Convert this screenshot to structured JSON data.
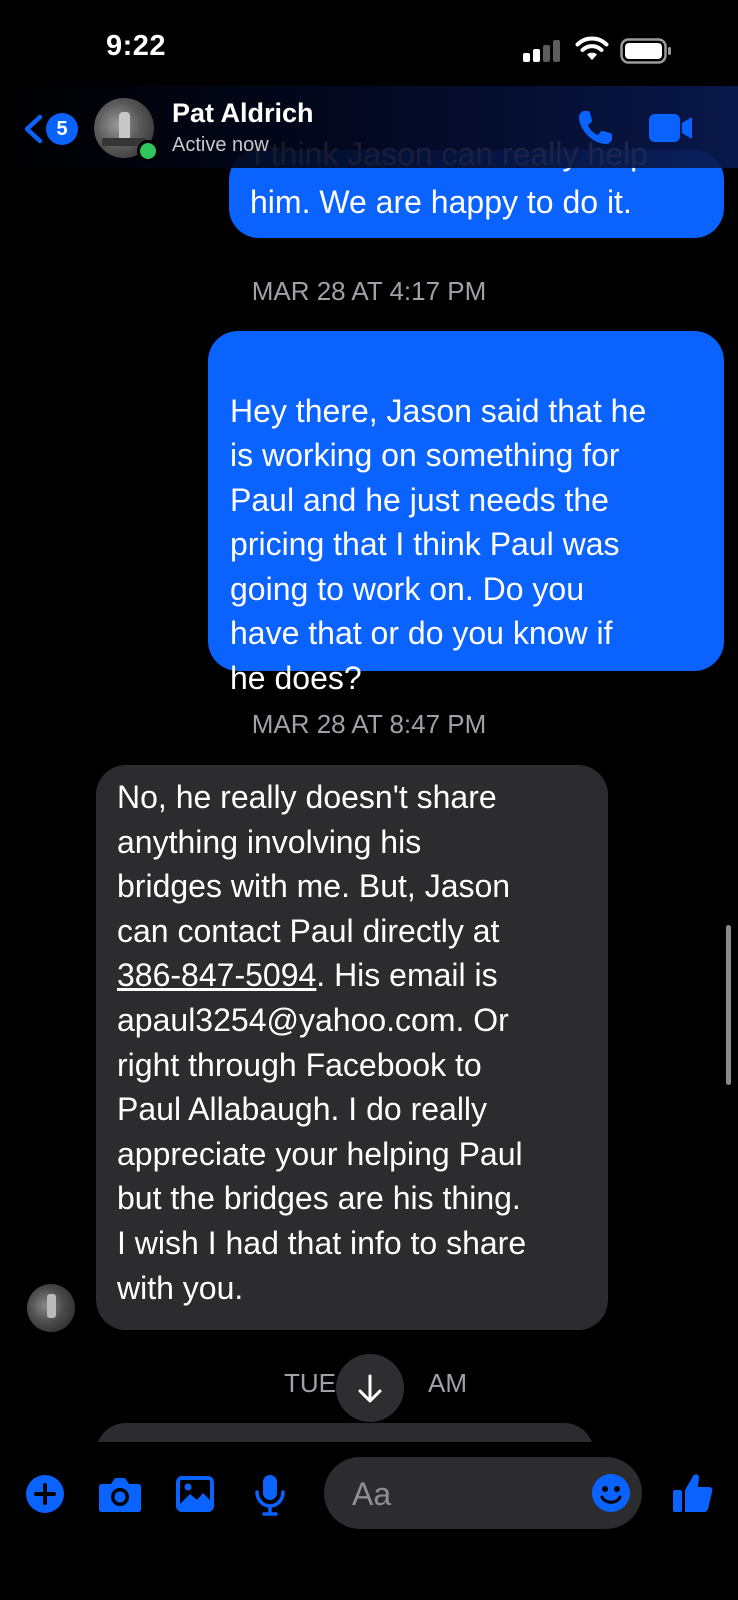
{
  "status_bar": {
    "time": "9:22"
  },
  "header": {
    "back_badge": "5",
    "contact_name": "Pat Aldrich",
    "contact_status": "Active now"
  },
  "messages": [
    {
      "direction": "outgoing",
      "text": "him. We are happy to do it.",
      "partial_hidden_line": "I think Jason can really help"
    },
    {
      "timestamp": "MAR 28 AT 4:17 PM"
    },
    {
      "direction": "outgoing",
      "text": "Hey there, Jason said that he\nis working on something for\nPaul and he just needs the\npricing that I think Paul was\ngoing to work on. Do you\nhave that or do you know if\nhe does?"
    },
    {
      "timestamp": "MAR 28 AT 8:47 PM"
    },
    {
      "direction": "incoming",
      "lines_before": "No,  he really doesn't share\nanything involving his\nbridges with me. But, Jason\ncan contact Paul directly at",
      "phone": "386-847-5094",
      "line_after_phone": ". His email is",
      "lines_after": "apaul3254@yahoo.com. Or\nright through Facebook to\nPaul Allabaugh. I do really\nappreciate your helping Paul\nbut the bridges are his thing.\nI wish I had that info to share\nwith you."
    },
    {
      "timestamp": "TUE … AM",
      "timestamp_left": "TUE",
      "timestamp_right": "AM"
    }
  ],
  "composer": {
    "placeholder": "Aa"
  },
  "colors": {
    "accent": "#0a62ff",
    "incoming_bubble": "#2c2c2e",
    "online": "#31c55b"
  },
  "icons": [
    "back-chevron-icon",
    "phone-icon",
    "video-icon",
    "plus-icon",
    "camera-icon",
    "image-icon",
    "microphone-icon",
    "emoji-icon",
    "thumbs-up-icon",
    "arrow-down-icon"
  ]
}
